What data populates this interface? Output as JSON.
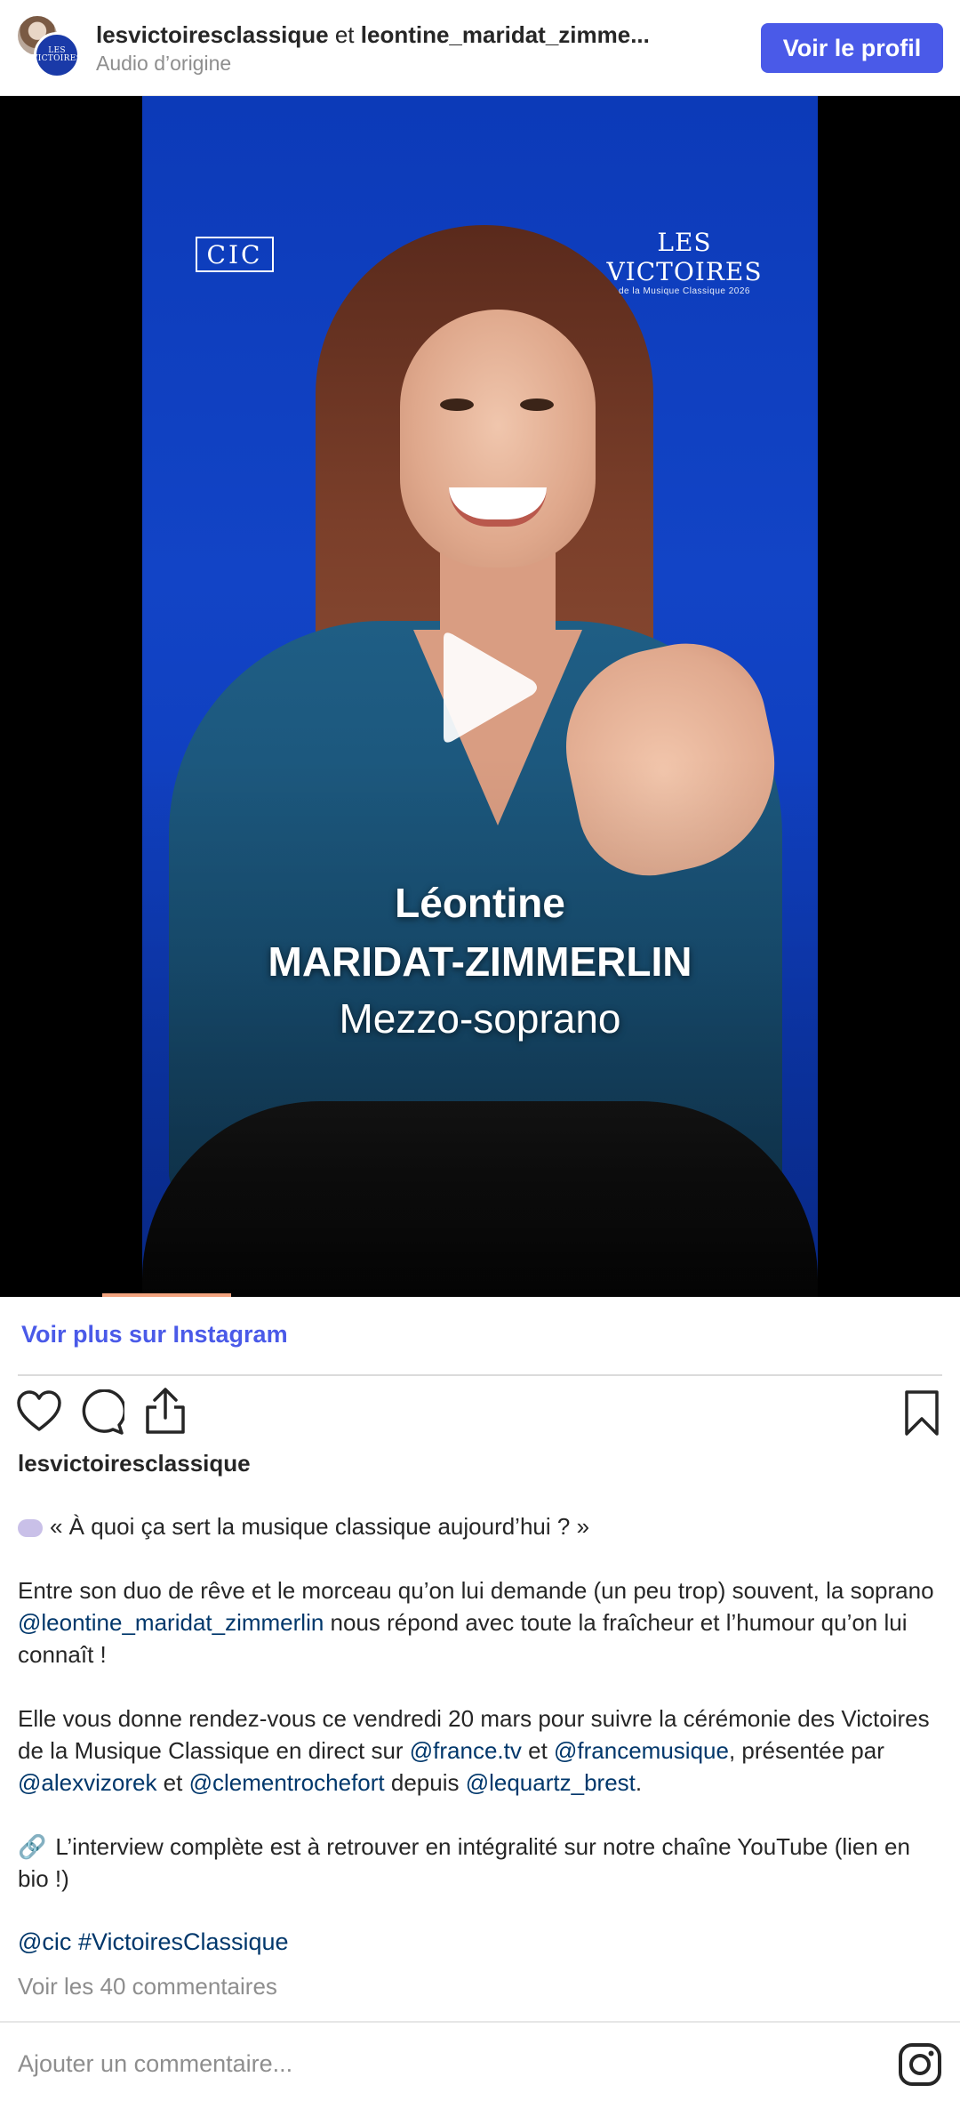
{
  "header": {
    "account_primary": "lesvictoiresclassique",
    "joiner": "et",
    "account_secondary": "leontine_maridat_zimme...",
    "audio_label": "Audio d’origine",
    "profile_button": "Voir le profil",
    "avatar_logo_text": "LES VICTOIRES"
  },
  "video": {
    "logo_left": "CIC",
    "logo_right_main": "LES VICTOIRES",
    "logo_right_sub": "de la Musique Classique 2026",
    "name_first": "Léontine",
    "name_last": "MARIDAT-ZIMMERLIN",
    "role": "Mezzo-soprano",
    "play_icon": "play-icon"
  },
  "links": {
    "more_on_instagram": "Voir plus sur Instagram"
  },
  "actions": {
    "like_icon": "heart-icon",
    "comment_icon": "comment-icon",
    "share_icon": "share-icon",
    "save_icon": "bookmark-icon"
  },
  "caption": {
    "username": "lesvictoiresclassique",
    "line1": "« À quoi ça sert la musique classique aujourd’hui ? »",
    "p2_a": "Entre son duo de rêve et le morceau qu’on lui demande (un peu trop) souvent, la soprano ",
    "p2_mention": "@leontine_maridat_zimmerlin",
    "p2_b": " nous répond avec toute la fraîcheur et l’humour qu’on lui connaît !",
    "p3_a": "Elle vous donne rendez-vous ce vendredi 20 mars pour suivre la cérémonie des Victoires de la Musique Classique en direct sur ",
    "p3_m1": "@france.tv",
    "p3_b": " et ",
    "p3_m2": "@francemusique",
    "p3_c": ", présentée par ",
    "p3_m3": "@alexvizorek",
    "p3_d": " et ",
    "p3_m4": "@clementrochefort",
    "p3_e": " depuis ",
    "p3_m5": "@lequartz_brest",
    "p3_f": ".",
    "p4": "L’interview complète est à retrouver en intégralité sur notre chaîne YouTube (lien en bio !)",
    "tag1": "@cic",
    "tag2": "#VictoiresClassique"
  },
  "comments": {
    "view_all": "Voir les 40 commentaires",
    "add_placeholder": "Ajouter un commentaire..."
  },
  "colors": {
    "accent": "#4a5ae8",
    "mention": "#00376b",
    "muted": "#8e8e8e",
    "video_bg": "#1244c6"
  }
}
